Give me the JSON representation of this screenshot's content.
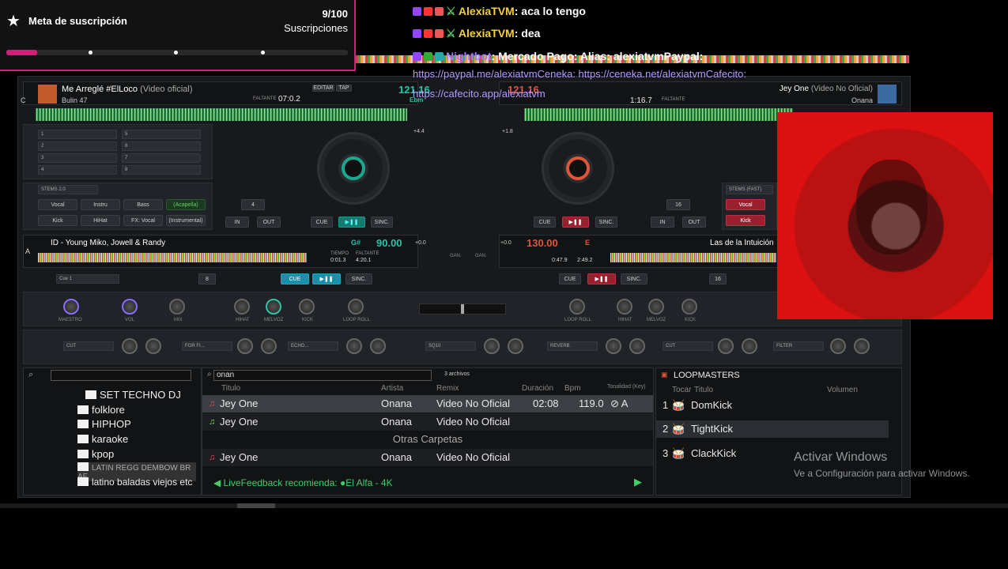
{
  "goal": {
    "title": "Meta de suscripción",
    "count": "9/100",
    "unit": "Suscripciones",
    "progress": 0.09
  },
  "chat": [
    {
      "user": "AlexiaTVM",
      "message": ": aca lo tengo"
    },
    {
      "user": "AlexiaTVM",
      "message": ": dea"
    },
    {
      "user": "Nightbot",
      "message": ": Mercado Pago: Alias: alexiatvmPaypal:"
    }
  ],
  "chat_links": {
    "line1": "https://paypal.me/alexiatvmCeneka: https://ceneka.net/alexiatvmCafecito:",
    "line2": "https://cafecito.app/alexiatvm"
  },
  "left_deck": {
    "letter": "C",
    "title": "Me Arreglé #ElLoco",
    "subtitle": "(Video oficial)",
    "artist": "Bulin 47",
    "remaining_label": "FALTANTE",
    "remaining": "07:0.2",
    "bpm": "121.16",
    "key_label": "Ebm",
    "edit": "EDITAR",
    "tap": "TAP",
    "pitch": "+4.4",
    "stems": "STEMS 2.0",
    "pads": [
      "Vocal",
      "Instru",
      "Bass",
      "(Acapella)",
      "Kick",
      "HiHat",
      "FX: Vocal",
      "(Instrumental)"
    ],
    "loop": "4",
    "in": "IN",
    "out": "OUT",
    "cue": "CUE",
    "sync": "SINC.",
    "hotcues": [
      "1",
      "2",
      "3",
      "4",
      "5",
      "6",
      "7",
      "8"
    ]
  },
  "right_deck": {
    "title": "Jey One",
    "subtitle": "(Video No Oficial)",
    "artist": "Onana",
    "remaining_label": "FALTANTE",
    "remaining": "1:16.7",
    "bpm": "121.16",
    "pitch": "+1.8",
    "stems": "STEMS (FAST)",
    "pads": [
      "Vocal",
      "Kick"
    ],
    "loop": "16",
    "in": "IN",
    "out": "OUT",
    "cue": "CUE",
    "sync": "SINC."
  },
  "deck_a": {
    "letter": "A",
    "title": "ID - Young Miko, Jowell & Randy",
    "key": "G#",
    "bpm": "90.00",
    "tiempo_label": "TIEMPO",
    "tiempo": "0:01.3",
    "faltante_label": "FALTANTE",
    "faltante": "4:20.1",
    "loop": "8",
    "cue": "CUE",
    "sync": "SINC.",
    "cue_slot": "Cue 1",
    "pitch": "+0.0"
  },
  "deck_b": {
    "title": "Las de la Intuición",
    "key": "E",
    "bpm": "130.00",
    "tiempo": "0:47.9",
    "faltante": "2:49.2",
    "loop": "16",
    "cue": "CUE",
    "sync": "SINC.",
    "pitch": "+0.0"
  },
  "mixer": {
    "knobs_left": [
      "MAESTRO",
      "VOL",
      "MIX"
    ],
    "eq_left": [
      "HIHAT",
      "MELVOZ",
      "KICK",
      "LOOP ROLL"
    ],
    "eq_right": [
      "LOOP ROLL",
      "HIHAT",
      "MELVOZ",
      "KICK"
    ],
    "gain": "GAN.",
    "fx_left": [
      "CUT",
      "FOR FI...",
      "ECHO..."
    ],
    "fx_left_knobs": [
      "STR",
      "LEN",
      "STR",
      "TYPE",
      "FBCK",
      "LEN"
    ],
    "fx_right": [
      "SQ10",
      "REVERB",
      "CUT",
      "FILTER"
    ],
    "fx_right_knobs": [
      "32 Hz",
      "80 Hz",
      "STR",
      "DEC",
      "STR",
      "LEN",
      "POS",
      "RES"
    ]
  },
  "browser": {
    "search": "onan",
    "count": "3 archivos",
    "columns": [
      "Titulo",
      "Artista",
      "Remix",
      "Duración",
      "Bpm",
      "Tonalidad (Key)"
    ],
    "tracks": [
      {
        "title": "Jey One",
        "artist": "Onana",
        "remix": "Video No Oficial",
        "duration": "02:08",
        "bpm": "119.0",
        "key": "A",
        "icon": "#e24a5a"
      },
      {
        "title": "Jey One",
        "artist": "Onana",
        "remix": "Video No Oficial",
        "duration": "",
        "bpm": "",
        "key": "",
        "icon": "#7be05b"
      }
    ],
    "other_folders": "Otras Carpetas",
    "other_tracks": [
      {
        "title": "Jey One",
        "artist": "Onana",
        "remix": "Video No Oficial"
      }
    ],
    "livefeedback": "LiveFeedback recomienda: ●El Alfa - 4K"
  },
  "folders": [
    "SET TECHNO DJ",
    "folklore",
    "HIPHOP",
    "karaoke",
    "kpop",
    "LATIN REGG DEMBOW BR AF",
    "latino baladas viejos etc"
  ],
  "sampler": {
    "title": "LOOPMASTERS",
    "col_play": "Tocar",
    "col_title": "Titulo",
    "col_volume": "Volumen",
    "items": [
      {
        "n": "1",
        "name": "DomKick"
      },
      {
        "n": "2",
        "name": "TightKick"
      },
      {
        "n": "3",
        "name": "ClackKick"
      }
    ]
  },
  "windows_watermark": {
    "title": "Activar Windows",
    "subtitle": "Ve a Configuración para activar Windows."
  },
  "colors": {
    "accent_teal": "#1aa890",
    "accent_red": "#e0553a",
    "goal_pink": "#d1207a",
    "chat_user": "#f4d03f",
    "nightbot": "#9f7bff"
  }
}
